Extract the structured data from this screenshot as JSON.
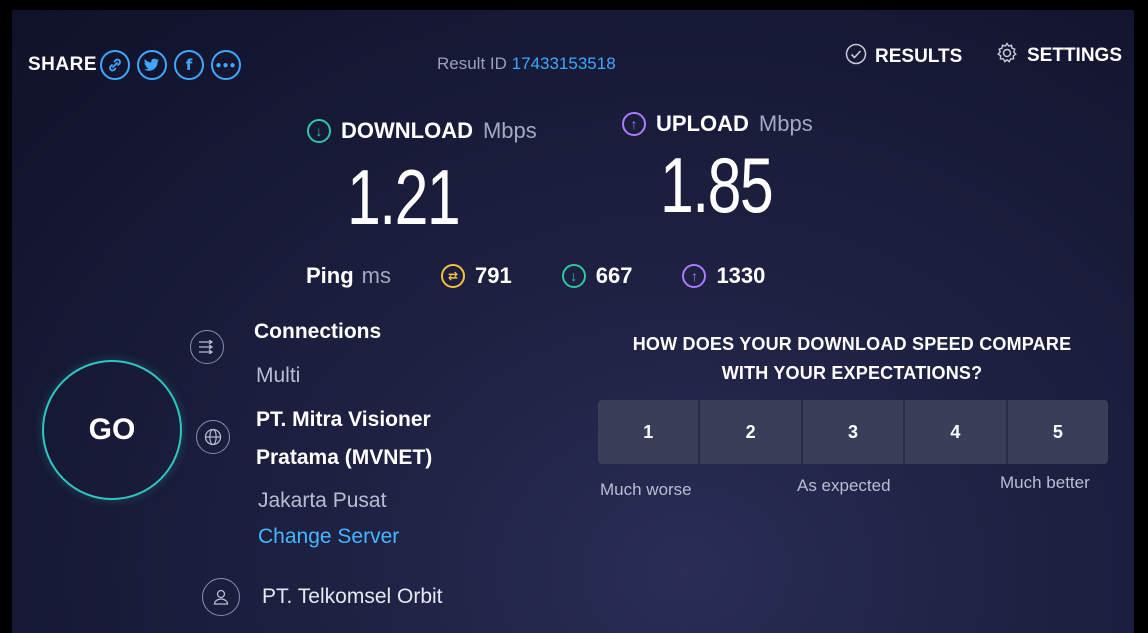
{
  "share": {
    "label": "SHARE",
    "buttons": [
      {
        "name": "link-icon",
        "glyph": "🔗"
      },
      {
        "name": "twitter-icon",
        "glyph": "t"
      },
      {
        "name": "facebook-icon",
        "glyph": "f"
      },
      {
        "name": "more-icon",
        "glyph": "•••"
      }
    ]
  },
  "result": {
    "label": "Result ID",
    "id": "17433153518"
  },
  "nav": {
    "results": "RESULTS",
    "settings": "SETTINGS"
  },
  "download": {
    "label": "DOWNLOAD",
    "unit": "Mbps",
    "value": "1.21",
    "icon": "arrow-down-circle-icon",
    "color": "#2ec6a4"
  },
  "upload": {
    "label": "UPLOAD",
    "unit": "Mbps",
    "value": "1.85",
    "icon": "arrow-up-circle-icon",
    "color": "#a97cff"
  },
  "ping": {
    "label": "Ping",
    "unit": "ms",
    "idle": "791",
    "down": "667",
    "up": "1330",
    "colors": {
      "idle": "#f5c242",
      "down": "#2ec6a4",
      "up": "#a97cff"
    }
  },
  "go": {
    "label": "GO"
  },
  "connections": {
    "title": "Connections",
    "value": "Multi"
  },
  "server": {
    "title_line1": "PT. Mitra Visioner",
    "title_line2": "Pratama (MVNET)",
    "location": "Jakarta Pusat",
    "change": "Change Server"
  },
  "provider": {
    "name": "PT. Telkomsel Orbit"
  },
  "survey": {
    "question_line1": "HOW DOES YOUR DOWNLOAD SPEED COMPARE",
    "question_line2": "WITH YOUR EXPECTATIONS?",
    "options": [
      "1",
      "2",
      "3",
      "4",
      "5"
    ],
    "low": "Much worse",
    "mid": "As expected",
    "high": "Much better"
  }
}
